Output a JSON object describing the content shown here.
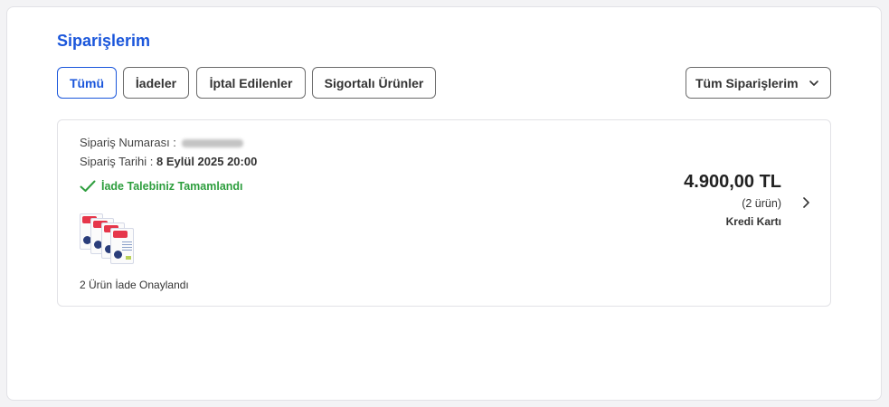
{
  "page": {
    "title": "Siparişlerim"
  },
  "filters": {
    "tabs": [
      {
        "label": "Tümü",
        "active": true
      },
      {
        "label": "İadeler",
        "active": false
      },
      {
        "label": "İptal Edilenler",
        "active": false
      },
      {
        "label": "Sigortalı Ürünler",
        "active": false
      }
    ],
    "dropdown": {
      "selected": "Tüm Siparişlerim",
      "icon": "chevron-down-icon"
    }
  },
  "order": {
    "number_label": "Sipariş Numarası :",
    "date_label": "Sipariş Tarihi :",
    "date_value": "8 Eylül 2025 20:00",
    "status": "İade Talebiniz Tamamlandı",
    "status_icon": "checkmark-icon",
    "result": "2 Ürün İade Onaylandı",
    "price": "4.900,00 TL",
    "item_count": "(2 ürün)",
    "payment": "Kredi Kartı",
    "arrow_icon": "chevron-right-icon"
  },
  "colors": {
    "accent": "#1a56db",
    "success": "#2e9e3e",
    "border": "#6b6b6b"
  }
}
